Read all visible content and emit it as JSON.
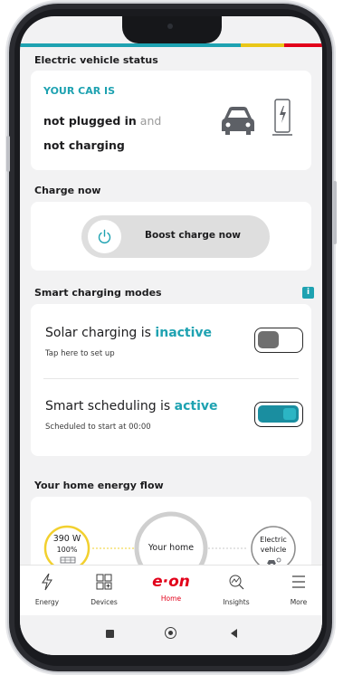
{
  "colors": {
    "accent_teal": "#1ea2b1",
    "brand_red": "#e2001a",
    "bar_teal": "#1ea2b1",
    "bar_yellow": "#e9c718",
    "solar_yellow": "#f2d02e"
  },
  "ev_status": {
    "title": "Electric vehicle status",
    "heading": "YOUR CAR IS",
    "line1_bold": "not plugged in",
    "line1_connector": "and",
    "line2_bold": "not charging",
    "icons": [
      "car-icon",
      "charger-icon"
    ]
  },
  "charge_now": {
    "title": "Charge now",
    "boost_label": "Boost charge now",
    "icon": "power-icon"
  },
  "smart_modes": {
    "title": "Smart charging modes",
    "info_icon": "info-icon",
    "solar": {
      "label_prefix": "Solar charging is",
      "status": "inactive",
      "subtitle": "Tap here to set up",
      "enabled": false
    },
    "scheduling": {
      "label_prefix": "Smart scheduling is",
      "status": "active",
      "subtitle": "Scheduled to start at 00:00",
      "enabled": true
    }
  },
  "energy_flow": {
    "title": "Your home energy flow",
    "solar_value": "390 W",
    "solar_percent": "100%",
    "home_label": "Your home",
    "ev_label_line1": "Electric",
    "ev_label_line2": "vehicle",
    "icons": [
      "solar-panel-icon",
      "house-icon",
      "ev-icon"
    ]
  },
  "nav": {
    "brand": "e·on",
    "items": [
      {
        "label": "Energy",
        "icon": "bolt-icon"
      },
      {
        "label": "Devices",
        "icon": "devices-icon"
      },
      {
        "label": "Home",
        "icon": "eon-logo",
        "active": true
      },
      {
        "label": "Insights",
        "icon": "insights-icon"
      },
      {
        "label": "More",
        "icon": "menu-icon"
      }
    ]
  },
  "system_nav": {
    "icons": [
      "recents-square-icon",
      "home-circle-icon",
      "back-triangle-icon"
    ]
  }
}
